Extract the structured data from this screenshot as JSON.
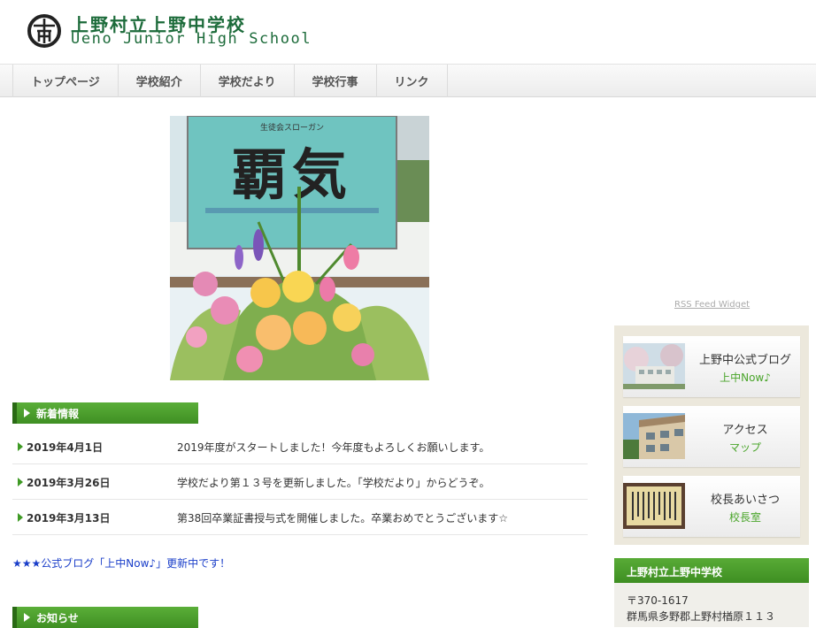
{
  "header": {
    "title_ja": "上野村立上野中学校",
    "title_en": "Ueno Junior High School",
    "logo_icon": "school-emblem-icon"
  },
  "nav": {
    "items": [
      "トップページ",
      "学校紹介",
      "学校だより",
      "学校行事",
      "リンク"
    ]
  },
  "hero": {
    "slogan_label": "生徒会スローガン",
    "slogan": "覇気"
  },
  "news": {
    "heading": "新着情報",
    "items": [
      {
        "date": "2019年4月1日",
        "text": "2019年度がスタートしました！今年度もよろしくお願いします。"
      },
      {
        "date": "2019年3月26日",
        "text": "学校だより第１３号を更新しました。「学校だより」からどうぞ。"
      },
      {
        "date": "2019年3月13日",
        "text": "第38回卒業証書授与式を開催しました。卒業おめでとうございます☆"
      }
    ],
    "blog_link": "★★★公式ブログ「上中Now♪」更新中です！"
  },
  "notice": {
    "heading": "お知らせ"
  },
  "sidebar": {
    "rss": "RSS Feed Widget",
    "cards": [
      {
        "title": "上野中公式ブログ",
        "sub": "上中Now♪"
      },
      {
        "title": "アクセス",
        "sub": "マップ"
      },
      {
        "title": "校長あいさつ",
        "sub": "校長室"
      }
    ],
    "school": {
      "heading": "上野村立上野中学校",
      "zip": "〒370-1617",
      "address": "群馬県多野郡上野村楢原１１３"
    }
  },
  "colors": {
    "brand_green": "#1c6b3a",
    "accent_green": "#4aa52b",
    "link_blue": "#1a3ec9"
  }
}
